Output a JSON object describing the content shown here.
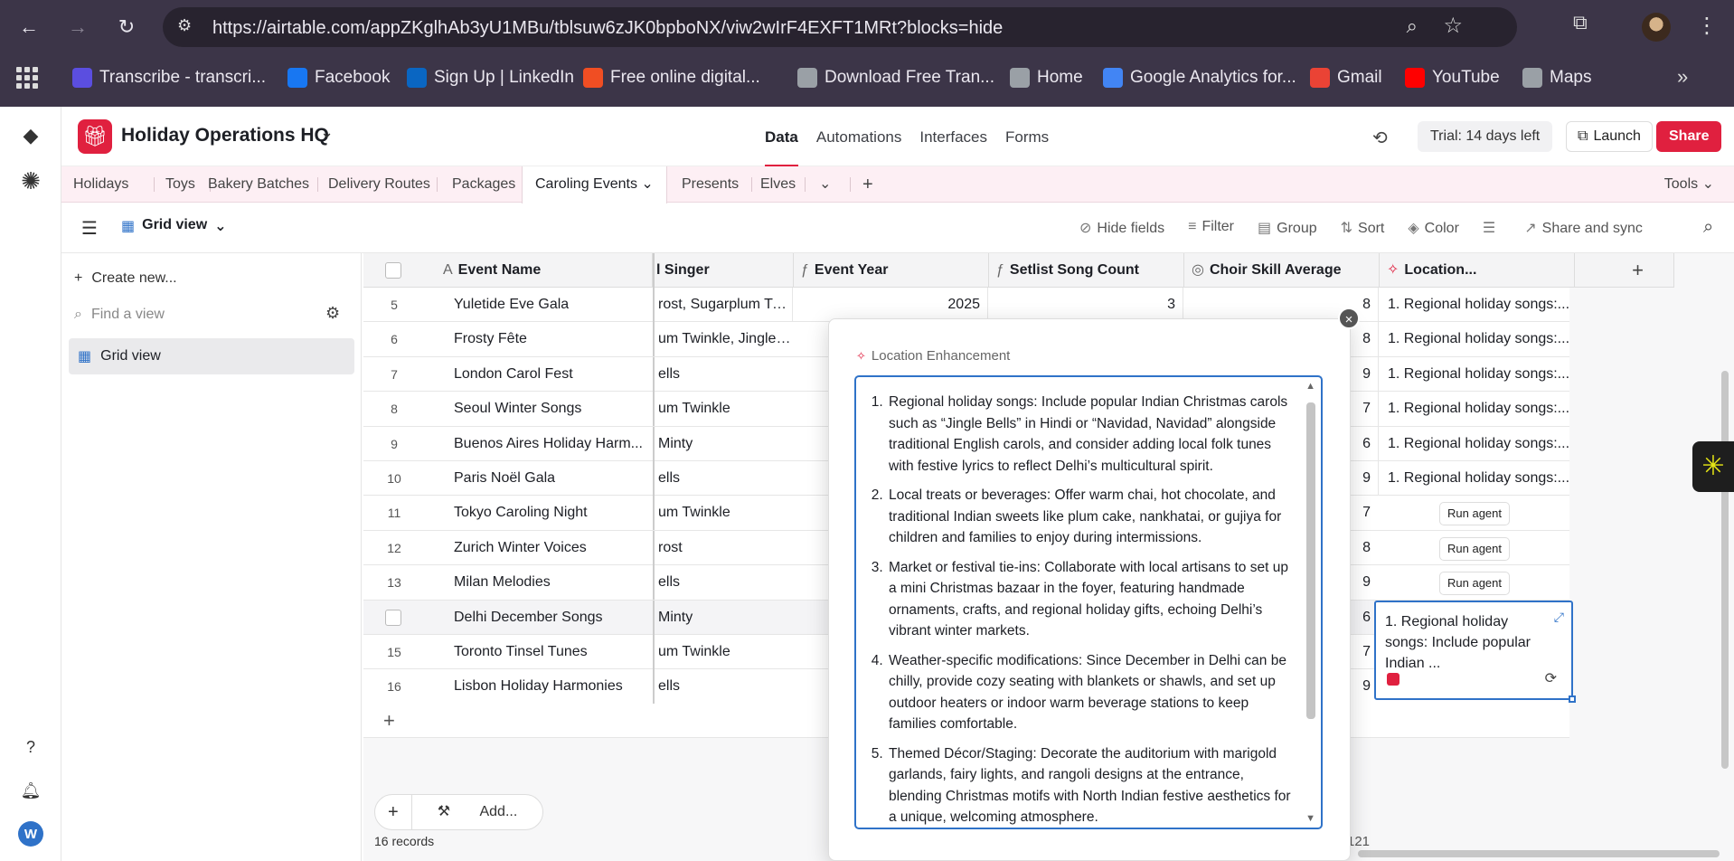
{
  "browser": {
    "url": "https://airtable.com/appZKglhAb3yU1MBu/tblsuw6zJK0bpboNX/viw2wIrF4EXFT1MRt?blocks=hide",
    "bookmarks": [
      {
        "label": "Transcribe - transcri...",
        "icon": "transcribe-icon",
        "color": "#5b4ee0"
      },
      {
        "label": "Facebook",
        "icon": "facebook-icon",
        "color": "#1877f2"
      },
      {
        "label": "Sign Up | LinkedIn",
        "icon": "linkedin-icon",
        "color": "#0a66c2"
      },
      {
        "label": "Free online digital...",
        "icon": "flame-icon",
        "color": "#f04e23"
      },
      {
        "label": "Download Free Tran...",
        "icon": "globe-icon",
        "color": "#9aa0a6"
      },
      {
        "label": "Home",
        "icon": "globe-icon",
        "color": "#9aa0a6"
      },
      {
        "label": "Google Analytics for...",
        "icon": "google-icon",
        "color": "#4285f4"
      },
      {
        "label": "Gmail",
        "icon": "gmail-icon",
        "color": "#ea4335"
      },
      {
        "label": "YouTube",
        "icon": "youtube-icon",
        "color": "#ff0000"
      },
      {
        "label": "Maps",
        "icon": "globe-icon",
        "color": "#9aa0a6"
      }
    ]
  },
  "base": {
    "title": "Holiday Operations HQ",
    "nav": [
      "Data",
      "Automations",
      "Interfaces",
      "Forms"
    ],
    "trial": "Trial: 14 days left",
    "launch": "Launch",
    "share": "Share"
  },
  "tabs": [
    "Holidays",
    "Toys",
    "Bakery Batches",
    "Delivery Routes",
    "Packages",
    "Caroling Events",
    "Presents",
    "Elves"
  ],
  "tools_label": "Tools",
  "view": {
    "name": "Grid view",
    "tools": [
      "Hide fields",
      "Filter",
      "Group",
      "Sort",
      "Color",
      "Share and sync"
    ]
  },
  "sidebar": {
    "create": "Create new...",
    "find_placeholder": "Find a view",
    "view_item": "Grid view"
  },
  "columns": {
    "event_name": "Event Name",
    "singer": "l Singer",
    "event_year": "Event Year",
    "song_count": "Setlist Song Count",
    "skill_avg": "Choir Skill Average",
    "location": "Location..."
  },
  "rows": [
    {
      "num": "5",
      "name": "Yuletide Eve Gala",
      "singer": "rost, Sugarplum Twi...",
      "year": "2025",
      "songs": "3",
      "skill": "8",
      "loc": "1. Regional holiday songs:..."
    },
    {
      "num": "6",
      "name": "Frosty Fête",
      "singer": "um Twinkle, Jingle F...",
      "year": "",
      "songs": "",
      "skill": "8",
      "loc": "1. Regional holiday songs:..."
    },
    {
      "num": "7",
      "name": "London Carol Fest",
      "singer": "ells",
      "year": "",
      "songs": "",
      "skill": "9",
      "loc": "1. Regional holiday songs:..."
    },
    {
      "num": "8",
      "name": "Seoul Winter Songs",
      "singer": "um Twinkle",
      "year": "",
      "songs": "",
      "skill": "7",
      "loc": "1. Regional holiday songs:..."
    },
    {
      "num": "9",
      "name": "Buenos Aires Holiday Harm...",
      "singer": "Minty",
      "year": "",
      "songs": "",
      "skill": "6",
      "loc": "1. Regional holiday songs:..."
    },
    {
      "num": "10",
      "name": "Paris Noël Gala",
      "singer": "ells",
      "year": "",
      "songs": "",
      "skill": "9",
      "loc": "1. Regional holiday songs:..."
    },
    {
      "num": "11",
      "name": "Tokyo Caroling Night",
      "singer": "um Twinkle",
      "year": "",
      "songs": "",
      "skill": "7",
      "loc": "",
      "agent": "Run agent"
    },
    {
      "num": "12",
      "name": "Zurich Winter Voices",
      "singer": "rost",
      "year": "",
      "songs": "",
      "skill": "8",
      "loc": "",
      "agent": "Run agent"
    },
    {
      "num": "13",
      "name": "Milan Melodies",
      "singer": "ells",
      "year": "",
      "songs": "",
      "skill": "9",
      "loc": "",
      "agent": "Run agent"
    },
    {
      "num": "",
      "name": "Delhi December Songs",
      "singer": "Minty",
      "year": "",
      "songs": "",
      "skill": "6",
      "loc": ""
    },
    {
      "num": "15",
      "name": "Toronto Tinsel Tunes",
      "singer": "um Twinkle",
      "year": "",
      "songs": "",
      "skill": "7",
      "loc": ""
    },
    {
      "num": "16",
      "name": "Lisbon Holiday Harmonies",
      "singer": "ells",
      "year": "",
      "songs": "",
      "skill": "9",
      "loc": ""
    }
  ],
  "footer": {
    "add": "Add...",
    "records": "16 records",
    "sum": "121"
  },
  "expanded_cell": {
    "text": "1. Regional holiday songs: Include popular Indian ..."
  },
  "popover": {
    "label": "Location Enhancement",
    "items": [
      "Regional holiday songs: Include popular Indian Christmas carols such as “Jingle Bells” in Hindi or “Navidad, Navidad” alongside traditional English carols, and consider adding local folk tunes with festive lyrics to reflect Delhi’s multicultural spirit.",
      "Local treats or beverages: Offer warm chai, hot chocolate, and traditional Indian sweets like plum cake, nankhatai, or gujiya for children and families to enjoy during intermissions.",
      "Market or festival tie-ins: Collaborate with local artisans to set up a mini Christmas bazaar in the foyer, featuring handmade ornaments, crafts, and regional holiday gifts, echoing Delhi’s vibrant winter markets.",
      "Weather-specific modifications: Since December in Delhi can be chilly, provide cozy seating with blankets or shawls, and set up outdoor heaters or indoor warm beverage stations to keep families comfortable.",
      "Themed Décor/Staging: Decorate the auditorium with marigold garlands, fairy lights, and rangoli designs at the entrance, blending Christmas motifs with North Indian festive aesthetics for a unique, welcoming atmosphere."
    ]
  },
  "colors": {
    "brand": "#e0203f",
    "accent": "#2f72c8"
  },
  "user_initial": "W"
}
